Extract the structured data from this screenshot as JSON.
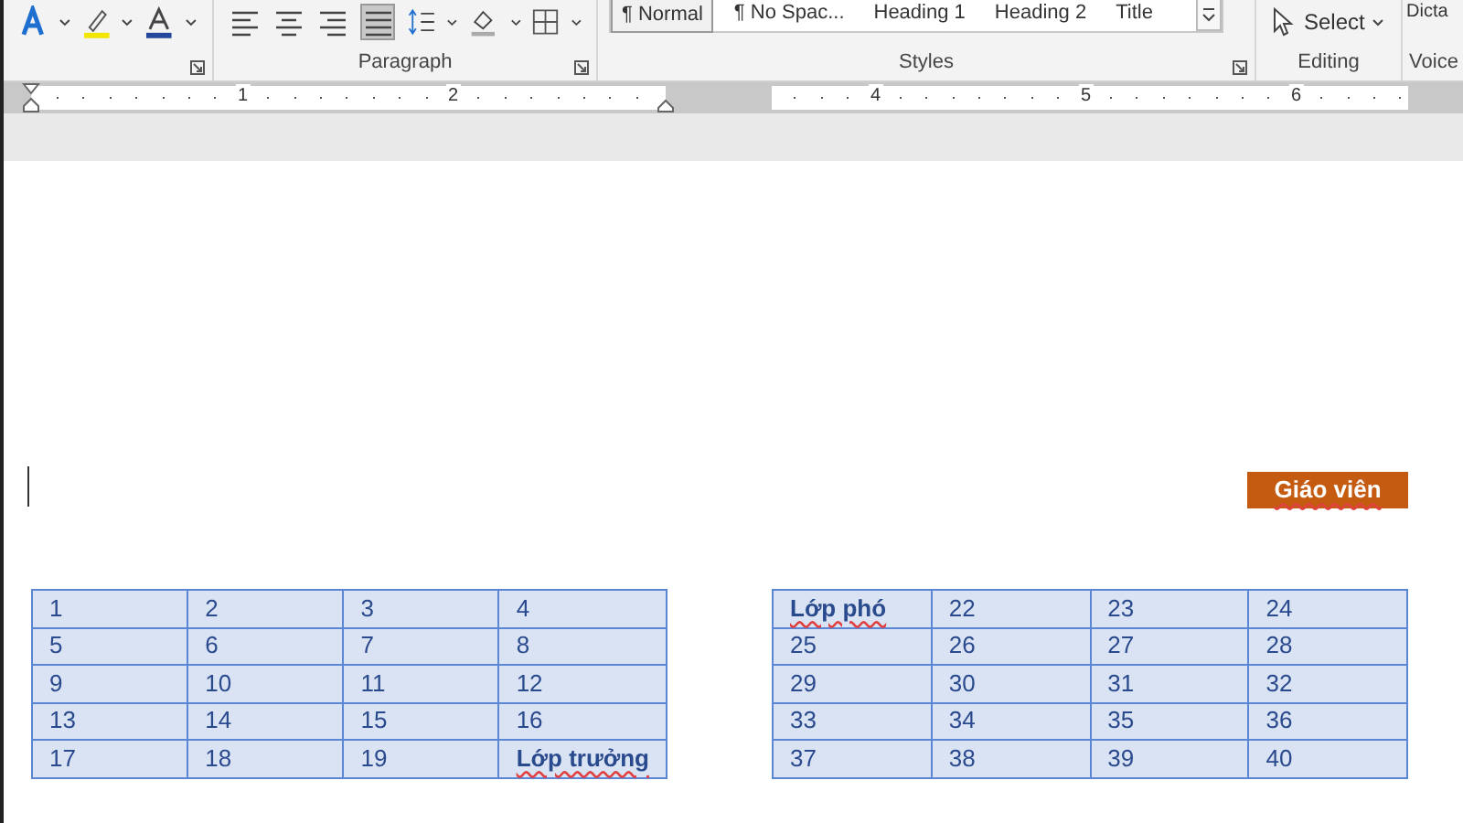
{
  "ribbon": {
    "groups": [
      {
        "kind": "font"
      },
      {
        "label": "Paragraph",
        "kind": "paragraph"
      },
      {
        "label": "Styles",
        "kind": "styles"
      },
      {
        "label": "Editing",
        "kind": "editing"
      },
      {
        "label": "Voice",
        "kind": "voice"
      }
    ],
    "alignment": [
      {
        "selected": false
      },
      {
        "selected": false
      },
      {
        "selected": false
      },
      {
        "selected": true
      }
    ],
    "styles": [
      {
        "label": "¶ Normal",
        "selected": true
      },
      {
        "label": "¶ No Spac...",
        "selected": false
      },
      {
        "label": "Heading 1",
        "selected": false
      },
      {
        "label": "Heading 2",
        "selected": false
      },
      {
        "label": "Title",
        "selected": false
      }
    ],
    "select_button": "Select",
    "dictate_button": "Dicta"
  },
  "ruler": {
    "numbers": [
      "1",
      "2",
      "4",
      "5",
      "6"
    ]
  },
  "document": {
    "label_box": {
      "text": "Giáo viên",
      "spelling_error": true
    },
    "tables": [
      {
        "rows": [
          [
            {
              "text": "1",
              "bold": false,
              "spelling_error": false
            },
            {
              "text": "2",
              "bold": false,
              "spelling_error": false
            },
            {
              "text": "3",
              "bold": false,
              "spelling_error": false
            },
            {
              "text": "4",
              "bold": false,
              "spelling_error": false
            }
          ],
          [
            {
              "text": "5",
              "bold": false,
              "spelling_error": false
            },
            {
              "text": "6",
              "bold": false,
              "spelling_error": false
            },
            {
              "text": "7",
              "bold": false,
              "spelling_error": false
            },
            {
              "text": "8",
              "bold": false,
              "spelling_error": false
            }
          ],
          [
            {
              "text": "9",
              "bold": false,
              "spelling_error": false
            },
            {
              "text": "10",
              "bold": false,
              "spelling_error": false
            },
            {
              "text": "11",
              "bold": false,
              "spelling_error": false
            },
            {
              "text": "12",
              "bold": false,
              "spelling_error": false
            }
          ],
          [
            {
              "text": "13",
              "bold": false,
              "spelling_error": false
            },
            {
              "text": "14",
              "bold": false,
              "spelling_error": false
            },
            {
              "text": "15",
              "bold": false,
              "spelling_error": false
            },
            {
              "text": "16",
              "bold": false,
              "spelling_error": false
            }
          ],
          [
            {
              "text": "17",
              "bold": false,
              "spelling_error": false
            },
            {
              "text": "18",
              "bold": false,
              "spelling_error": false
            },
            {
              "text": "19",
              "bold": false,
              "spelling_error": false
            },
            {
              "text": "Lớp trưởng",
              "bold": true,
              "spelling_error": true
            }
          ]
        ]
      },
      {
        "rows": [
          [
            {
              "text": "Lớp phó",
              "bold": true,
              "spelling_error": true
            },
            {
              "text": "22",
              "bold": false,
              "spelling_error": false
            },
            {
              "text": "23",
              "bold": false,
              "spelling_error": false
            },
            {
              "text": "24",
              "bold": false,
              "spelling_error": false
            }
          ],
          [
            {
              "text": "25",
              "bold": false,
              "spelling_error": false
            },
            {
              "text": "26",
              "bold": false,
              "spelling_error": false
            },
            {
              "text": "27",
              "bold": false,
              "spelling_error": false
            },
            {
              "text": "28",
              "bold": false,
              "spelling_error": false
            }
          ],
          [
            {
              "text": "29",
              "bold": false,
              "spelling_error": false
            },
            {
              "text": "30",
              "bold": false,
              "spelling_error": false
            },
            {
              "text": "31",
              "bold": false,
              "spelling_error": false
            },
            {
              "text": "32",
              "bold": false,
              "spelling_error": false
            }
          ],
          [
            {
              "text": "33",
              "bold": false,
              "spelling_error": false
            },
            {
              "text": "34",
              "bold": false,
              "spelling_error": false
            },
            {
              "text": "35",
              "bold": false,
              "spelling_error": false
            },
            {
              "text": "36",
              "bold": false,
              "spelling_error": false
            }
          ],
          [
            {
              "text": "37",
              "bold": false,
              "spelling_error": false
            },
            {
              "text": "38",
              "bold": false,
              "spelling_error": false
            },
            {
              "text": "39",
              "bold": false,
              "spelling_error": false
            },
            {
              "text": "40",
              "bold": false,
              "spelling_error": false
            }
          ]
        ]
      }
    ]
  }
}
